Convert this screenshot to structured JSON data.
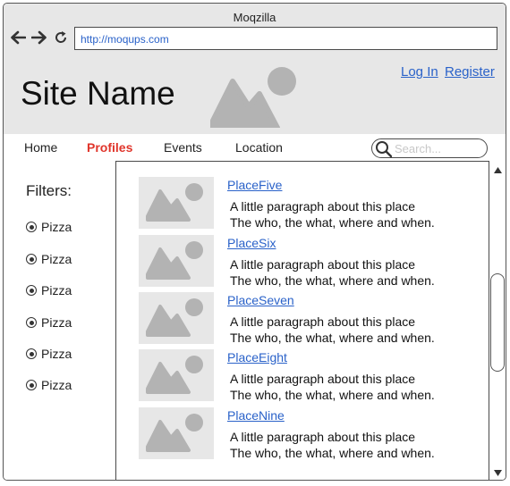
{
  "window": {
    "title": "Moqzilla",
    "url": "http://moqups.com"
  },
  "header": {
    "site_name": "Site Name",
    "login": "Log In",
    "register": "Register"
  },
  "menu": {
    "items": [
      {
        "label": "Home",
        "active": false
      },
      {
        "label": "Profiles",
        "active": true
      },
      {
        "label": "Events",
        "active": false
      },
      {
        "label": "Location",
        "active": false
      }
    ],
    "search_placeholder": "Search..."
  },
  "filters": {
    "title": "Filters:",
    "items": [
      "Pizza",
      "Pizza",
      "Pizza",
      "Pizza",
      "Pizza",
      "Pizza"
    ]
  },
  "places": [
    {
      "name": "PlaceFive",
      "line1": "A little paragraph about this place",
      "line2": "The who, the what, where and when."
    },
    {
      "name": "PlaceSix",
      "line1": "A little paragraph about this place",
      "line2": "The who, the what, where and when."
    },
    {
      "name": "PlaceSeven",
      "line1": "A little paragraph about this place",
      "line2": "The who, the what, where and when."
    },
    {
      "name": "PlaceEight",
      "line1": "A little paragraph about this place",
      "line2": "The who, the what, where and when."
    },
    {
      "name": "PlaceNine",
      "line1": "A little paragraph about this place",
      "line2": "The who, the what, where and when."
    }
  ],
  "colors": {
    "link": "#2a62c9",
    "active_menu": "#e0352b",
    "chrome": "#e7e7e7",
    "placeholder_image": "#b3b3b3"
  }
}
